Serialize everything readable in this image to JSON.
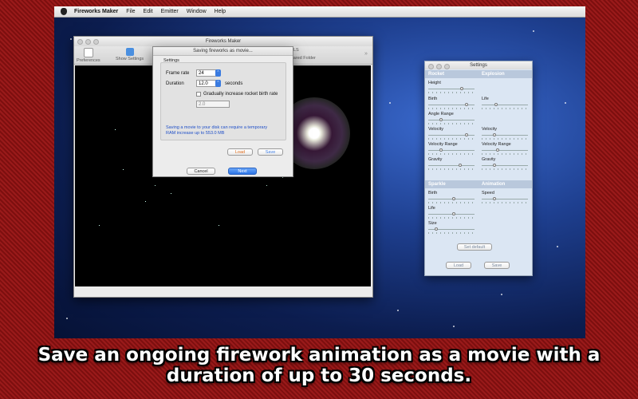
{
  "menubar": {
    "app_name": "Fireworks Maker",
    "items": [
      "File",
      "Edit",
      "Emitter",
      "Window",
      "Help"
    ]
  },
  "main_window": {
    "title": "Fireworks Maker",
    "toolbar": {
      "preferences_label": "Preferences",
      "show_settings_label": "Show Settings",
      "shared_folder_label": "Shared Folder",
      "right_fragment": "LS"
    }
  },
  "dialog": {
    "title": "Saving fireworks as movie...",
    "group_label": "Settings",
    "frame_rate_label": "Frame rate",
    "frame_rate_value": "24",
    "duration_label": "Duration",
    "duration_value": "12.0",
    "duration_unit": "seconds",
    "gradual_label": "Gradually increase rocket birth rate",
    "gradual_value": "2.0",
    "note": "Saving a movie to your disk can require a temporary RAM increase up to 553.0 MB",
    "load_label": "Load",
    "save_label": "Save",
    "cancel_label": "Cancel",
    "next_label": "Next"
  },
  "settings_panel": {
    "title": "Settings",
    "sections": {
      "rocket": "Rocket",
      "explosion": "Explosion",
      "sparkle": "Sparkle",
      "animation": "Animation"
    },
    "rocket": [
      "Height",
      "Birth",
      "Angle Range",
      "Velocity",
      "Velocity Range",
      "Gravity"
    ],
    "explosion": [
      "Life",
      "Velocity",
      "Velocity Range",
      "Gravity"
    ],
    "sparkle": [
      "Birth",
      "Life",
      "Size"
    ],
    "animation": [
      "Speed"
    ],
    "set_default_label": "Set default",
    "load_label": "Load",
    "save_label": "Save"
  },
  "caption": "Save an ongoing firework animation as a movie with a duration of up to 30 seconds."
}
